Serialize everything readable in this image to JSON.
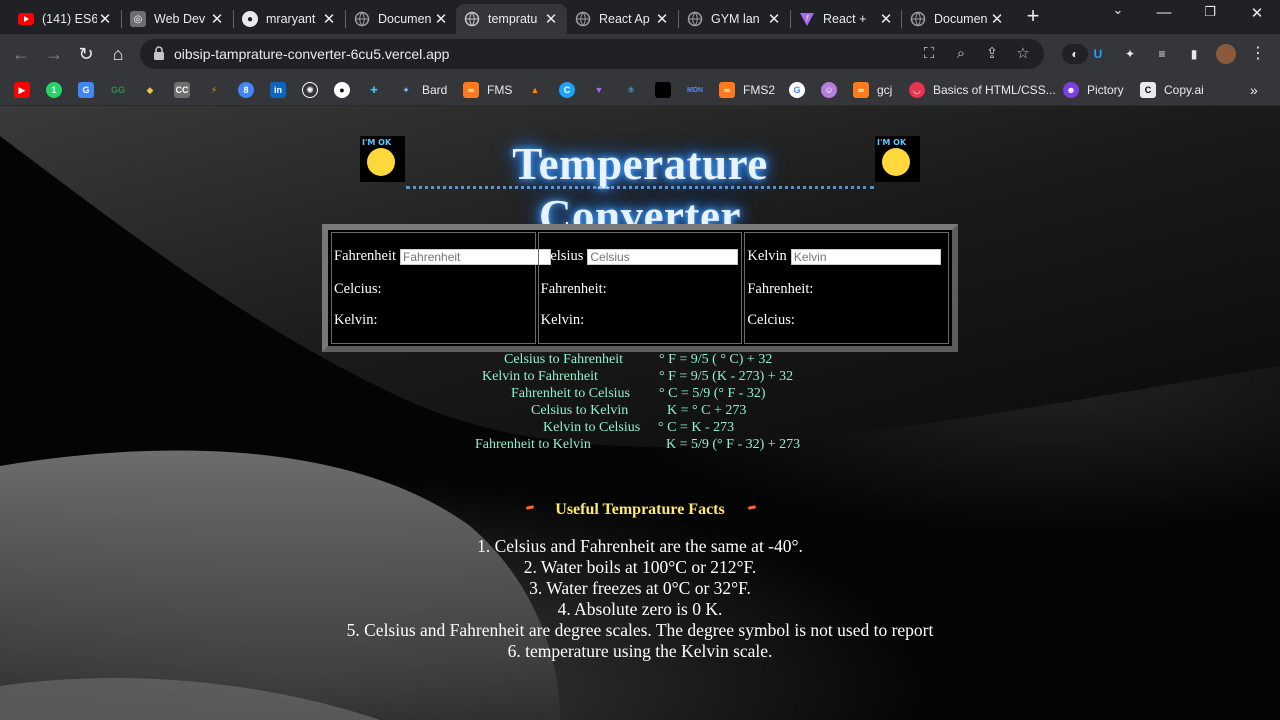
{
  "browser": {
    "tabs": [
      {
        "label": "(141) ES6",
        "icon": "youtube-icon",
        "color": "#ff0000"
      },
      {
        "label": "Web Dev",
        "icon": "chatgpt-icon",
        "color": "#6b6f72"
      },
      {
        "label": "mraryant",
        "icon": "github-icon",
        "color": "#e8eaed"
      },
      {
        "label": "Documen",
        "icon": "globe-icon",
        "color": "#9aa0a6"
      },
      {
        "label": "tempratu",
        "icon": "globe-icon",
        "color": "#9aa0a6",
        "active": true
      },
      {
        "label": "React Ap",
        "icon": "globe-icon",
        "color": "#9aa0a6"
      },
      {
        "label": "GYM lan",
        "icon": "globe-icon",
        "color": "#9aa0a6"
      },
      {
        "label": "React +",
        "icon": "vite-icon",
        "color": "#a56bff"
      },
      {
        "label": "Documen",
        "icon": "globe-icon",
        "color": "#9aa0a6"
      }
    ],
    "url": "oibsip-tamprature-converter-6cu5.vercel.app",
    "bookmarks": [
      {
        "label": "",
        "icon": "youtube-icon",
        "color": "#ff0000"
      },
      {
        "label": "",
        "icon": "whatsapp-icon",
        "color": "#25d366"
      },
      {
        "label": "",
        "icon": "translate-icon",
        "color": "#4285f4"
      },
      {
        "label": "",
        "icon": "gfg-icon",
        "color": "#2f8d46"
      },
      {
        "label": "",
        "icon": "codeforces-icon",
        "color": "#f5c242"
      },
      {
        "label": "",
        "icon": "cc-icon",
        "color": "#6e6e6e"
      },
      {
        "label": "",
        "icon": "stackblitz-icon",
        "color": "#f08a24"
      },
      {
        "label": "",
        "icon": "chrome-badge-icon",
        "color": "#4285f4"
      },
      {
        "label": "",
        "icon": "linkedin-icon",
        "color": "#0a66c2"
      },
      {
        "label": "",
        "icon": "openai-icon",
        "color": "#ffffff"
      },
      {
        "label": "",
        "icon": "github-icon",
        "color": "#ffffff"
      },
      {
        "label": "",
        "icon": "slack-icon",
        "color": "#36c5f0"
      },
      {
        "label": "Bard",
        "icon": "bard-icon",
        "color": "#8ab4f8"
      },
      {
        "label": "FMS",
        "icon": "fms-icon",
        "color": "#ff7a1a"
      },
      {
        "label": "",
        "icon": "mountain-icon",
        "color": "#ff8c00"
      },
      {
        "label": "",
        "icon": "c-icon",
        "color": "#1ea2ff"
      },
      {
        "label": "",
        "icon": "vue-icon",
        "color": "#a56bff"
      },
      {
        "label": "",
        "icon": "react-icon",
        "color": "#61dafb"
      },
      {
        "label": "",
        "icon": "black-square-icon",
        "color": "#000000"
      },
      {
        "label": "",
        "icon": "mdn-icon",
        "color": "#4a8cf7"
      },
      {
        "label": "FMS2",
        "icon": "fms-icon",
        "color": "#ff7a1a"
      },
      {
        "label": "",
        "icon": "google-icon",
        "color": "#ffffff"
      },
      {
        "label": "",
        "icon": "profile-icon",
        "color": "#b57edc"
      },
      {
        "label": "gcj",
        "icon": "fms-icon",
        "color": "#ff7a1a"
      },
      {
        "label": "Basics of HTML/CSS...",
        "icon": "beaker-icon",
        "color": "#e8344e"
      },
      {
        "label": "Pictory",
        "icon": "pictory-icon",
        "color": "#7b3fe4"
      },
      {
        "label": "Copy.ai",
        "icon": "copyai-icon",
        "color": "#e8eaed"
      }
    ]
  },
  "page": {
    "title": "Temperature Converter",
    "emoji_text": "I'M OK",
    "converter": {
      "fahrenheit": {
        "label": "Fahrenheit",
        "placeholder": "Fahrenheit",
        "out1": "Celcius:",
        "out2": "Kelvin:"
      },
      "celsius": {
        "label": "Celsius",
        "placeholder": "Celsius",
        "out1": "Fahrenheit:",
        "out2": "Kelvin:"
      },
      "kelvin": {
        "label": "Kelvin",
        "placeholder": "Kelvin",
        "out1": "Fahrenheit:",
        "out2": "Celcius:"
      }
    },
    "formulas": [
      {
        "name": "Celsius to Fahrenheit",
        "formula": "° F = 9/5 ( ° C) + 32"
      },
      {
        "name": "Kelvin to Fahrenheit",
        "formula": "° F = 9/5 (K - 273) + 32"
      },
      {
        "name": "Fahrenheit to Celsius",
        "formula": "° C = 5/9 (° F - 32)"
      },
      {
        "name": "Celsius to Kelvin",
        "formula": "K = ° C + 273"
      },
      {
        "name": "Kelvin to Celsius",
        "formula": "° C = K - 273"
      },
      {
        "name": "Fahrenheit to Kelvin",
        "formula": "K = 5/9 (° F - 32) + 273"
      }
    ],
    "facts_title": "Useful Temprature Facts",
    "facts": [
      "1.  Celsius and Fahrenheit are the same at -40°.",
      "2.  Water boils at 100°C or 212°F.",
      "3.  Water freezes at 0°C or 32°F.",
      "4.  Absolute zero is 0 K.",
      "5.  Celsius and Fahrenheit are degree scales. The degree symbol is not used to report",
      "6.  temperature using the Kelvin scale."
    ]
  }
}
